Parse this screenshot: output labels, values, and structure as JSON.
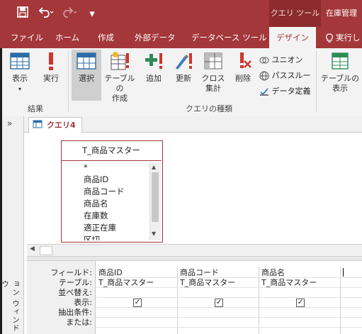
{
  "titlebar": {
    "context_tools": "クエリ ツール",
    "app_title": "在庫管理",
    "customize_symbol": "▾"
  },
  "tabs": [
    {
      "label": "ファイル"
    },
    {
      "label": "ホーム"
    },
    {
      "label": "作成"
    },
    {
      "label": "外部データ"
    },
    {
      "label": "データベース ツール"
    },
    {
      "label": "デザイン"
    },
    {
      "label": "実行し"
    }
  ],
  "ribbon": {
    "results": {
      "view": "表示",
      "run": "実行",
      "group_label": "結果"
    },
    "query_type": {
      "select": "選択",
      "make_table_1": "テーブルの",
      "make_table_2": "作成",
      "append": "追加",
      "update": "更新",
      "crosstab_1": "クロス",
      "crosstab_2": "集計",
      "delete": "削除",
      "union": "ユニオン",
      "passthrough": "パススルー",
      "data_definition": "データ定義",
      "group_label": "クエリの種類"
    },
    "show_table_1": "テーブルの",
    "show_table_2": "表示"
  },
  "nav": {
    "toggle": "»",
    "label": "ョン ウィンドウ"
  },
  "doc_tab": {
    "label": "クエリ4"
  },
  "table": {
    "title": "T_商品マスター",
    "fields": [
      "*",
      "商品ID",
      "商品コード",
      "商品名",
      "在庫数",
      "適正在庫",
      "区切"
    ]
  },
  "grid": {
    "row_headers": [
      "フィールド:",
      "テーブル:",
      "並べ替え:",
      "表示:",
      "抽出条件:",
      "または:"
    ],
    "columns": [
      {
        "field": "商品ID",
        "table": "T_商品マスター",
        "show": true
      },
      {
        "field": "商品コード",
        "table": "T_商品マスター",
        "show": true
      },
      {
        "field": "商品名",
        "table": "T_商品マスター",
        "show": true
      }
    ]
  },
  "colors": {
    "accent": "#a4373a",
    "ribbon_bg": "#f3f3f3"
  }
}
